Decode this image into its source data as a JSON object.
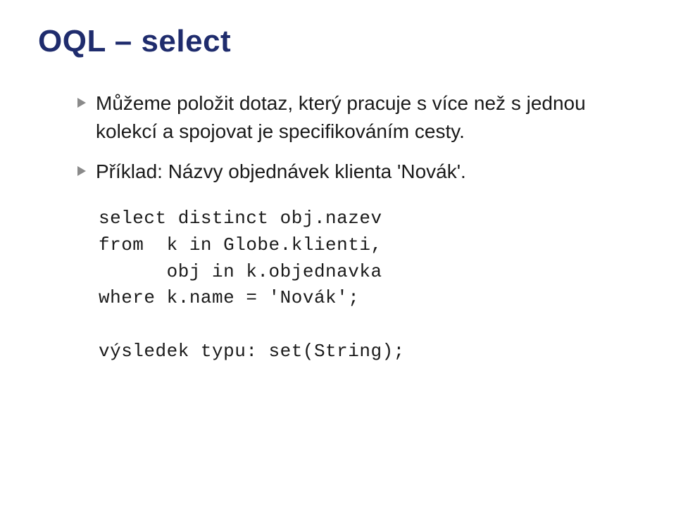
{
  "title": "OQL – select",
  "bullets": [
    "Můžeme položit dotaz, který pracuje s více než s jednou kolekcí a spojovat je specifikováním cesty.",
    "Příklad: Názvy objednávek klienta 'Novák'."
  ],
  "code": "select distinct obj.nazev\nfrom  k in Globe.klienti,\n      obj in k.objednavka\nwhere k.name = 'Novák';\n\nvýsledek typu: set(String);",
  "colors": {
    "title": "#1f2c6d",
    "bullet_arrow": "#8a8a8a",
    "text": "#1a1a1a"
  },
  "icons": {
    "bullet_arrow": "triangle-right-icon"
  }
}
